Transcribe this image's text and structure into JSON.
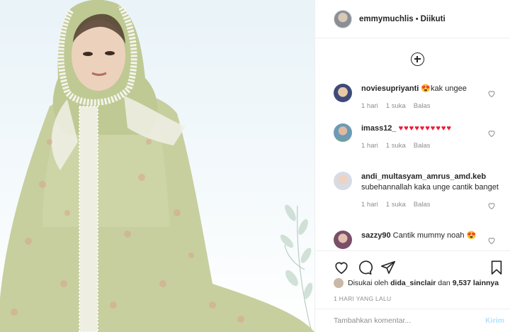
{
  "post": {
    "username": "emmymuchlis",
    "separator": "•",
    "follow_status": "Diikuti"
  },
  "comments": [
    {
      "user": "noviesupriyanti",
      "text": "😍kak ungee",
      "time": "1 hari",
      "likes": "1 suka",
      "reply": "Balas"
    },
    {
      "user": "imass12_",
      "text": "♥♥♥♥♥♥♥♥♥♥",
      "time": "1 hari",
      "likes": "1 suka",
      "reply": "Balas"
    },
    {
      "user": "andi_multasyam_amrus_amd.keb",
      "text": "subehannallah kaka unge cantik banget",
      "time": "1 hari",
      "likes": "1 suka",
      "reply": "Balas"
    },
    {
      "user": "sazzy90",
      "text": "Cantik mummy noah 😍",
      "time": "",
      "likes": "",
      "reply": ""
    }
  ],
  "likes": {
    "prefix": "Disukai oleh",
    "liker": "dida_sinclair",
    "connector": "dan",
    "others": "9,537 lainnya"
  },
  "timestamp": "1 HARI YANG LALU",
  "add_comment": {
    "placeholder": "Tambahkan komentar...",
    "send_label": "Kirim"
  },
  "colors": {
    "heart_red": "#ed1c3c",
    "send_disabled": "#b2dffc",
    "meta_grey": "#8e8e8e"
  }
}
